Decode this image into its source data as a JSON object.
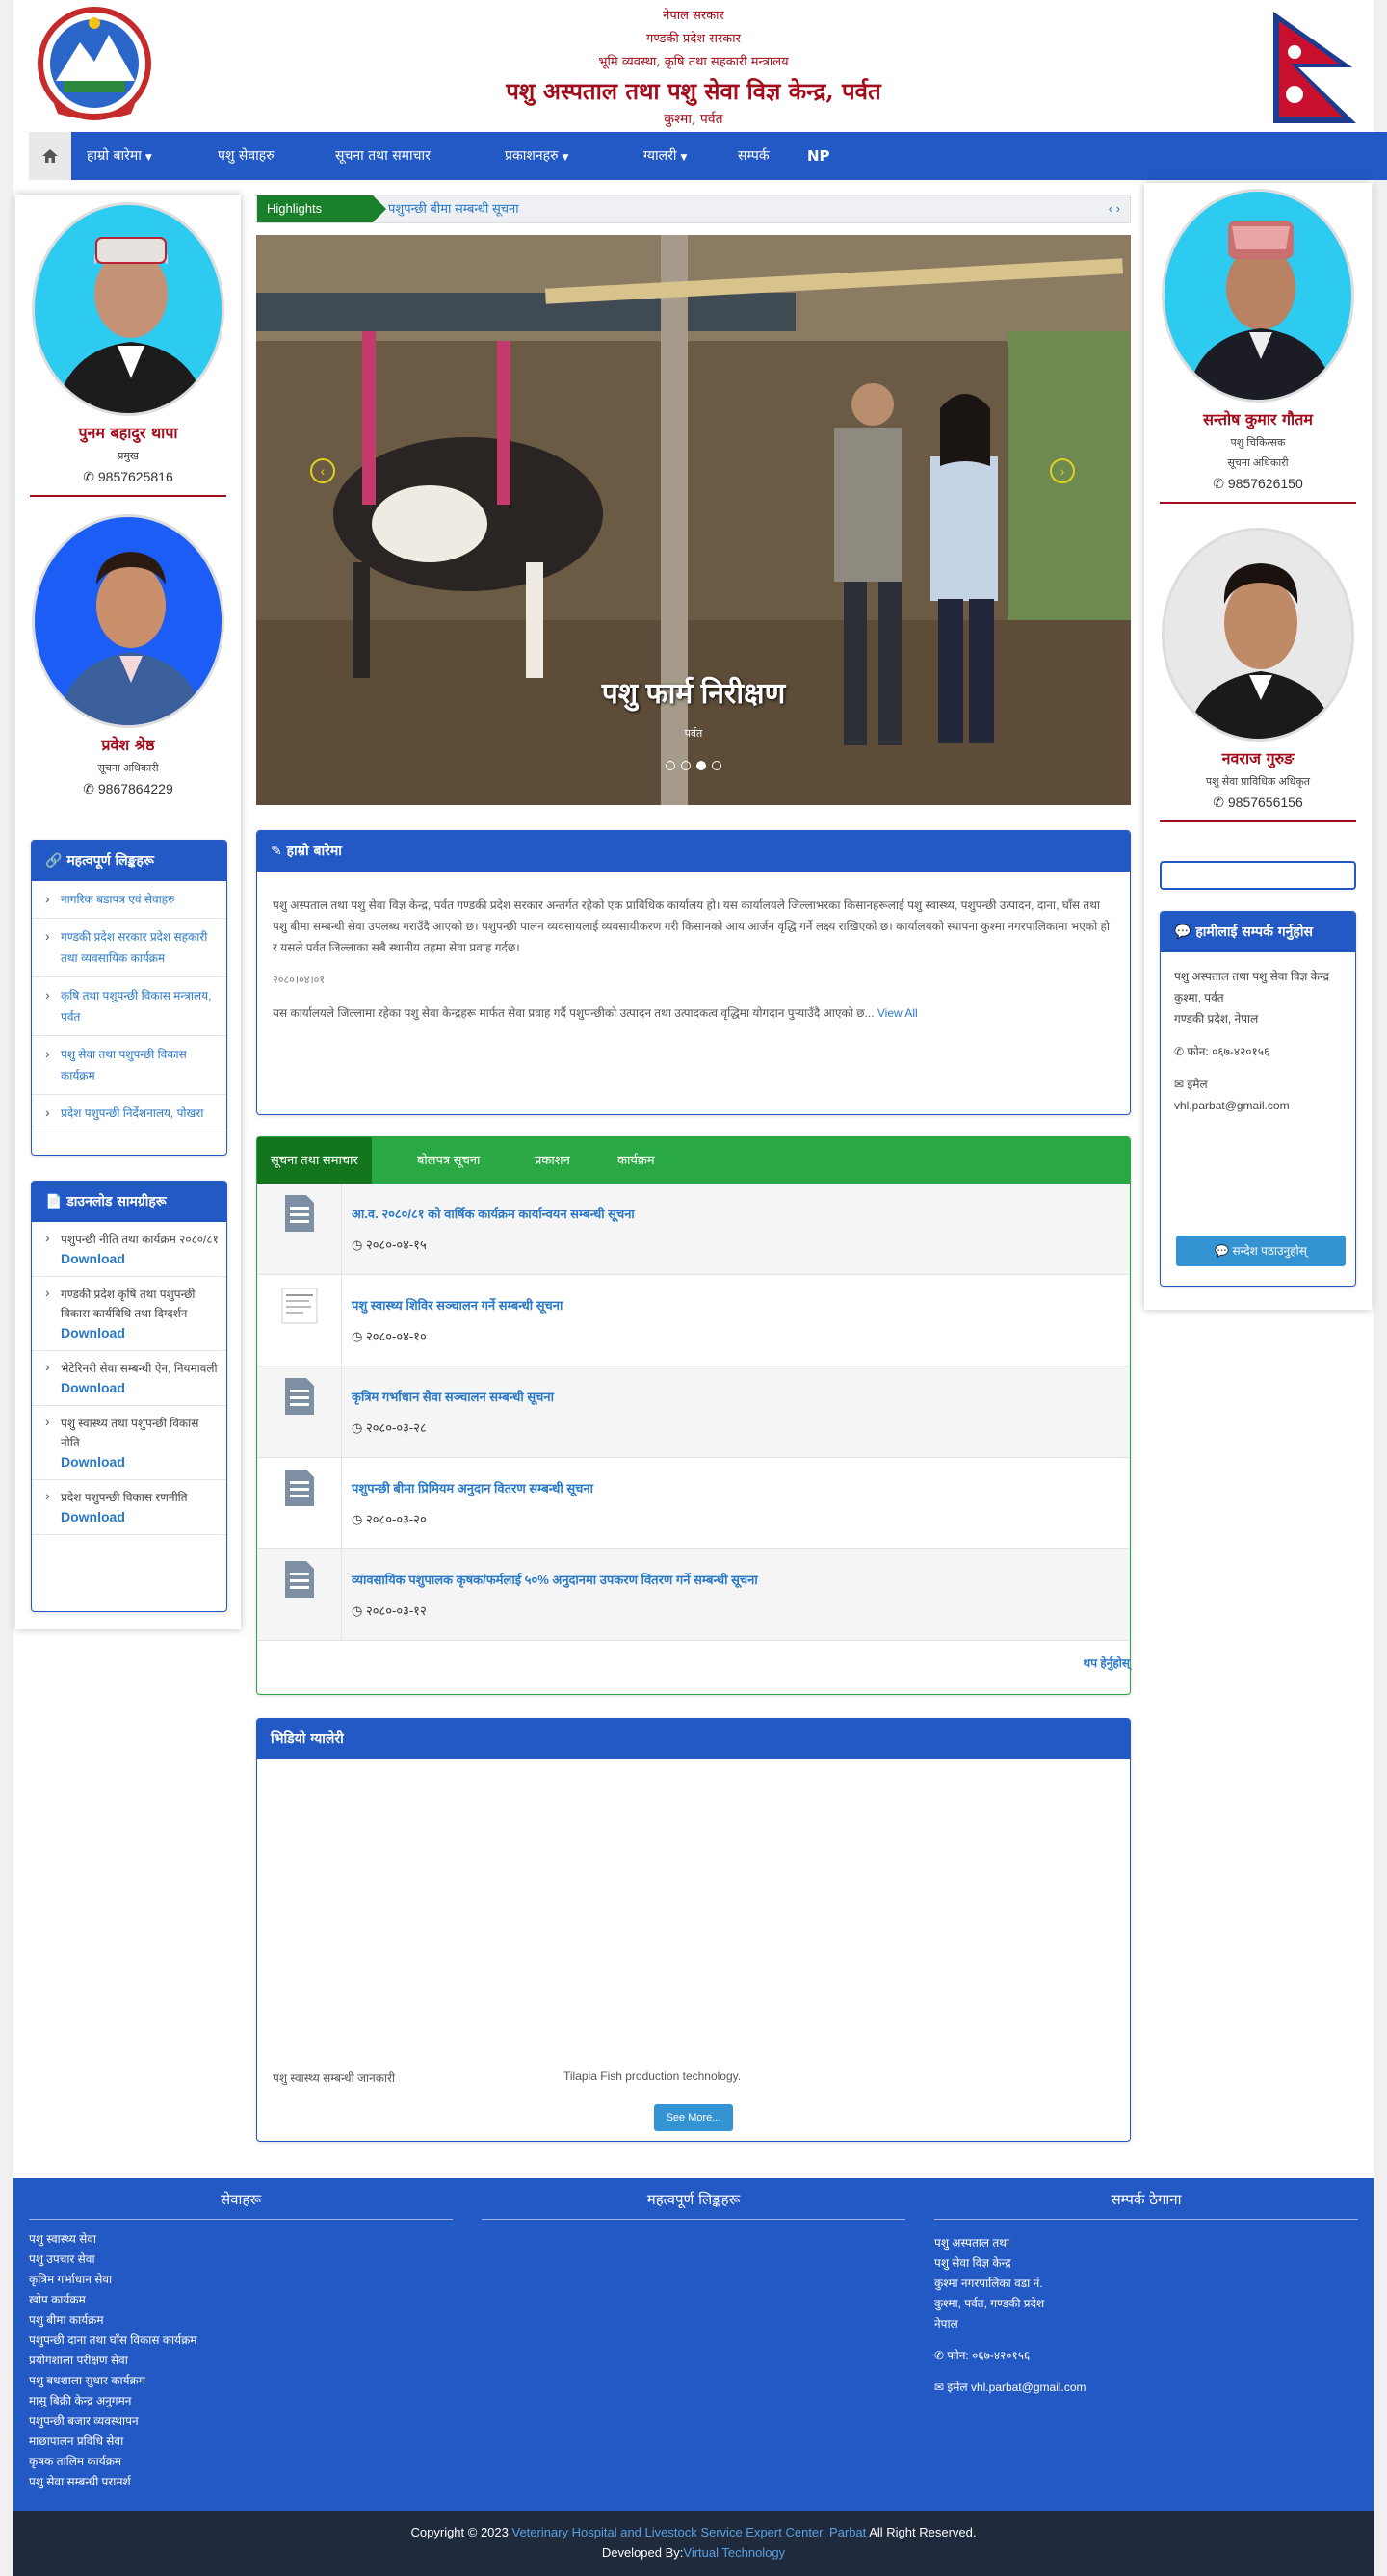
{
  "header": {
    "line1": "नेपाल सरकार",
    "line2": "गण्डकी प्रदेश सरकार",
    "line3": "भूमि व्यवस्था, कृषि तथा सहकारी मन्त्रालय",
    "title": "पशु अस्पताल तथा पशु सेवा विज्ञ केन्द्र, पर्वत",
    "location": "कुश्मा, पर्वत"
  },
  "nav": {
    "items": [
      "हाम्रो बारेमा",
      "पशु सेवाहरु",
      "सूचना तथा समाचार",
      "प्रकाशनहरु",
      "ग्यालरी",
      "सम्पर्क",
      "NP"
    ]
  },
  "officials_left": [
    {
      "name": "पुनम बहादुर थापा",
      "role": "प्रमुख",
      "phone": "9857625816",
      "bg": "#2ecbf0"
    },
    {
      "name": "प्रवेश श्रेष्ठ",
      "role": "सूचना अधिकारी",
      "phone": "9867864229",
      "bg": "#1c5ef5"
    }
  ],
  "officials_right": [
    {
      "name": "सन्तोष कुमार गौतम",
      "role1": "पशु चिकित्सक",
      "role2": "सूचना अधिकारी",
      "phone": "9857626150",
      "bg": "#2ecbf0"
    },
    {
      "name": "नवराज गुरुङ",
      "role1": "पशु सेवा प्राविधिक अधिकृत",
      "role2": "",
      "phone": "9857656156",
      "bg": "#e8e8e8"
    }
  ],
  "quick_links": {
    "title": "महत्वपूर्ण लिङ्कहरू",
    "items": [
      "नागरिक बडापत्र एवं सेवाहरु",
      "गण्डकी प्रदेश सरकार प्रदेश सहकारी तथा व्यवसायिक कार्यक्रम",
      "कृषि तथा पशुपन्छी विकास मन्त्रालय, पर्वत",
      "पशु सेवा तथा पशुपन्छी विकास कार्यक्रम",
      "प्रदेश पशुपन्छी निर्देशनालय, पोखरा"
    ]
  },
  "downloads": {
    "title": "डाउनलोड सामग्रीहरू",
    "download_label": "Download",
    "items": [
      "पशुपन्छी नीति तथा कार्यक्रम २०८०/८१",
      "गण्डकी प्रदेश कृषि तथा पशुपन्छी विकास कार्यविधि तथा दिग्दर्शन",
      "भेटेरिनरी सेवा सम्बन्धी ऐन, नियमावली",
      "पशु स्वास्थ्य तथा पशुपन्छी विकास नीति",
      "प्रदेश पशुपन्छी विकास रणनीति"
    ]
  },
  "ticker": {
    "label": "Highlights",
    "text": "पशुपन्छी बीमा सम्बन्धी सूचना",
    "controls": "‹ ›"
  },
  "slider": {
    "caption": "पशु फार्म निरीक्षण",
    "subcaption": "पर्वत",
    "dots": 4,
    "active_dot": 2
  },
  "about": {
    "title": "हाम्रो बारेमा",
    "text": "पशु अस्पताल तथा पशु सेवा विज्ञ केन्द्र, पर्वत गण्डकी प्रदेश सरकार अन्तर्गत रहेको एक प्राविधिक कार्यालय हो। यस कार्यालयले जिल्लाभरका किसानहरूलाई पशु स्वास्थ्य, पशुपन्छी उत्पादन, दाना, घाँस तथा पशु बीमा सम्बन्धी सेवा उपलब्ध गराउँदै आएको छ। पशुपन्छी पालन व्यवसायलाई व्यवसायीकरण गरी किसानको आय आर्जन वृद्धि गर्ने लक्ष्य राखिएको छ। कार्यालयको स्थापना कुश्मा नगरपालिकामा भएको हो र यसले पर्वत जिल्लाका सबै स्थानीय तहमा सेवा प्रवाह गर्दछ।",
    "date": "२०८०।०४।०१",
    "text2": "यस कार्यालयले जिल्लामा रहेका पशु सेवा केन्द्रहरू मार्फत सेवा प्रवाह गर्दै पशुपन्छीको उत्पादन तथा उत्पादकत्व वृद्धिमा योगदान पुर्‍याउँदै आएको छ",
    "view_all": "View All"
  },
  "news_tabs": {
    "tabs": [
      "सूचना तथा समाचार",
      "बोलपत्र सूचना",
      "प्रकाशन",
      "कार्यक्रम"
    ],
    "items": [
      {
        "title": "आ.व. २०८०/८१ को वार्षिक कार्यक्रम कार्यान्वयन सम्बन्धी सूचना",
        "date": "२०८०-०४-१५"
      },
      {
        "title": "पशु स्वास्थ्य शिविर सञ्चालन गर्ने सम्बन्धी सूचना",
        "date": "२०८०-०४-१०"
      },
      {
        "title": "कृत्रिम गर्भाधान सेवा सञ्चालन सम्बन्धी सूचना",
        "date": "२०८०-०३-२८"
      },
      {
        "title": "पशुपन्छी बीमा प्रिमियम अनुदान वितरण सम्बन्धी सूचना",
        "date": "२०८०-०३-२०"
      },
      {
        "title": "व्यावसायिक पशुपालक कृषक/फर्मलाई ५०% अनुदानमा उपकरण वितरण गर्ने सम्बन्धी सूचना",
        "date": "२०८०-०३-१२"
      }
    ],
    "more": "थप हेर्नुहोस्"
  },
  "videos": {
    "title": "भिडियो ग्यालेरी",
    "caption1": "पशु स्वास्थ्य सम्बन्धी जानकारी",
    "caption2": "Tilapia Fish production technology.",
    "see_more": "See More..."
  },
  "contact": {
    "title": "हामीलाई सम्पर्क गर्नुहोस",
    "office": "पशु अस्पताल तथा पशु सेवा विज्ञ केन्द्र",
    "addr": "कुश्मा, पर्वत",
    "addr2": "गण्डकी प्रदेश, नेपाल",
    "phone_label": "फोन:",
    "phone": "०६७-४२०१५६",
    "email_label": "इमेल",
    "email": "vhl.parbat@gmail.com",
    "message_button": "सन्देश पठाउनुहोस्"
  },
  "footer": {
    "col1_title": "सेवाहरू",
    "col1_items": [
      "पशु स्वास्थ्य सेवा",
      "पशु उपचार सेवा",
      "कृत्रिम गर्भाधान सेवा",
      "खोप कार्यक्रम",
      "पशु बीमा कार्यक्रम",
      "पशुपन्छी दाना तथा घाँस विकास कार्यक्रम",
      "प्रयोगशाला परीक्षण सेवा",
      "पशु बधशाला सुधार कार्यक्रम",
      "मासु बिक्री केन्द्र अनुगमन",
      "पशुपन्छी बजार व्यवस्थापन",
      "माछापालन प्रविधि सेवा",
      "कृषक तालिम कार्यक्रम",
      "पशु सेवा सम्बन्धी परामर्श"
    ],
    "col2_title": "महत्वपूर्ण लिङ्कहरू",
    "col3_title": "सम्पर्क ठेगाना",
    "col3_items": [
      "पशु अस्पताल तथा",
      "पशु सेवा विज्ञ केन्द्र",
      "कुश्मा नगरपालिका वडा नं.",
      "कुश्मा, पर्वत, गण्डकी प्रदेश",
      "नेपाल"
    ],
    "phone_label": "फोन:",
    "phone": "०६७-४२०१५६",
    "email_label": "इमेल",
    "email": "vhl.parbat@gmail.com"
  },
  "copyright": {
    "prefix": "Copyright © 2023",
    "org": "Veterinary Hospital and Livestock Service Expert Center, Parbat",
    "suffix": "All Right Reserved.",
    "dev_prefix": "Developed By:",
    "dev": "Virtual Technology"
  },
  "colors": {
    "primary": "#2359c4",
    "accent_red": "#a30d1b",
    "green": "#2aa844",
    "link": "#2a7ac7"
  }
}
